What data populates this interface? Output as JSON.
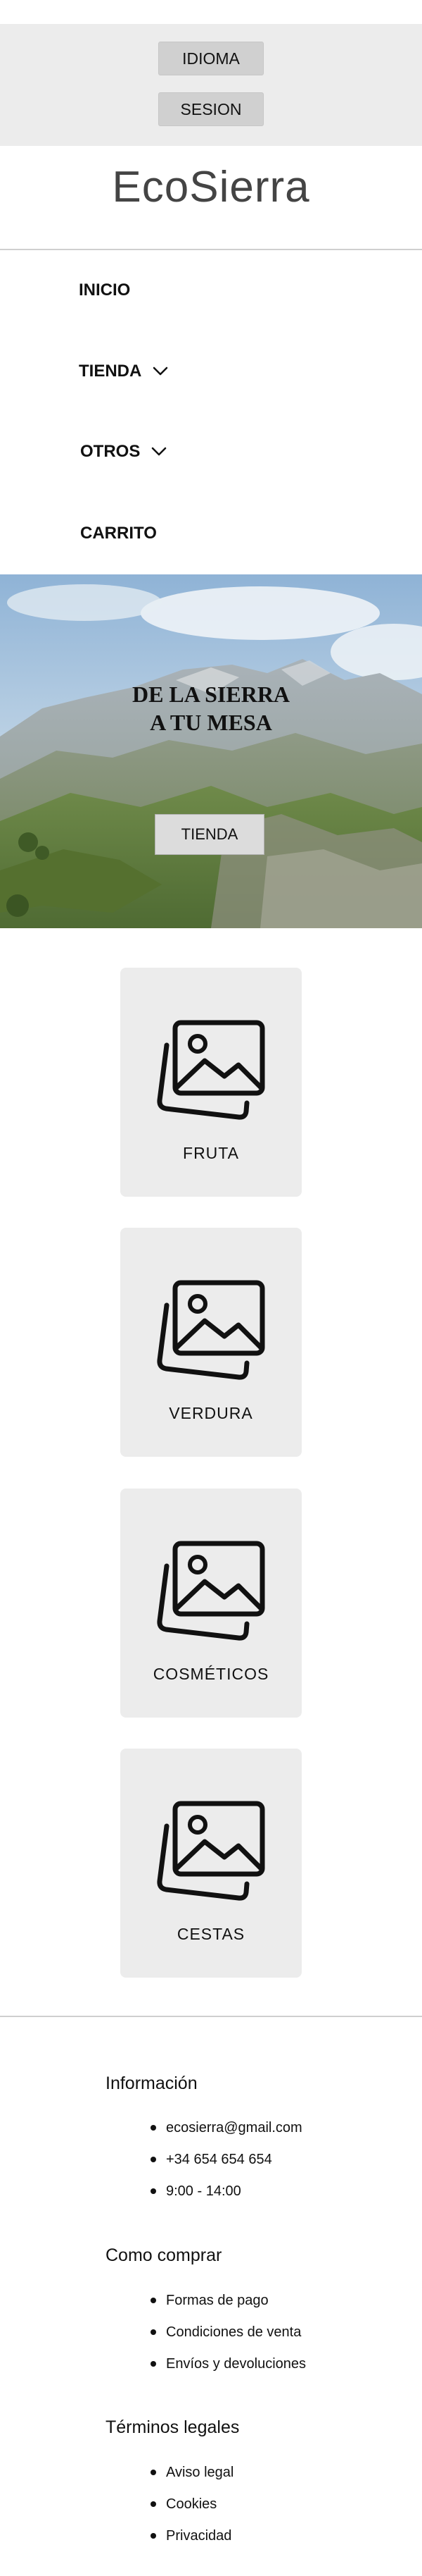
{
  "header": {
    "idioma_label": "IDIOMA",
    "sesion_label": "SESION",
    "brand": "EcoSierra"
  },
  "nav": {
    "items": [
      {
        "label": "INICIO",
        "icon": ""
      },
      {
        "label": "TIENDA",
        "icon": "chevron-down-icon"
      },
      {
        "label": "OTROS",
        "icon": "chevron-down-icon"
      },
      {
        "label": "CARRITO",
        "icon": ""
      }
    ]
  },
  "hero": {
    "title_line1": "DE LA SIERRA",
    "title_line2": "A TU MESA",
    "button_label": "TIENDA"
  },
  "categories": [
    {
      "label": "FRUTA",
      "icon": "image-placeholder-icon"
    },
    {
      "label": "VERDURA",
      "icon": "image-placeholder-icon"
    },
    {
      "label": "COSMÉTICOS",
      "icon": "image-placeholder-icon"
    },
    {
      "label": "CESTAS",
      "icon": "image-placeholder-icon"
    }
  ],
  "footer": {
    "sections": [
      {
        "title": "Información",
        "items": [
          "ecosierra@gmail.com",
          "+34 654 654 654",
          "9:00 - 14:00"
        ]
      },
      {
        "title": "Como comprar",
        "items": [
          "Formas de pago",
          "Condiciones de venta",
          "Envíos y devoluciones"
        ]
      },
      {
        "title": "Términos legales",
        "items": [
          "Aviso legal",
          "Cookies",
          "Privacidad"
        ]
      }
    ]
  },
  "colors": {
    "topbar_bg": "#ececec",
    "button_bg": "#d0d0d0",
    "card_bg": "#ececec",
    "brand_text": "#444444"
  }
}
